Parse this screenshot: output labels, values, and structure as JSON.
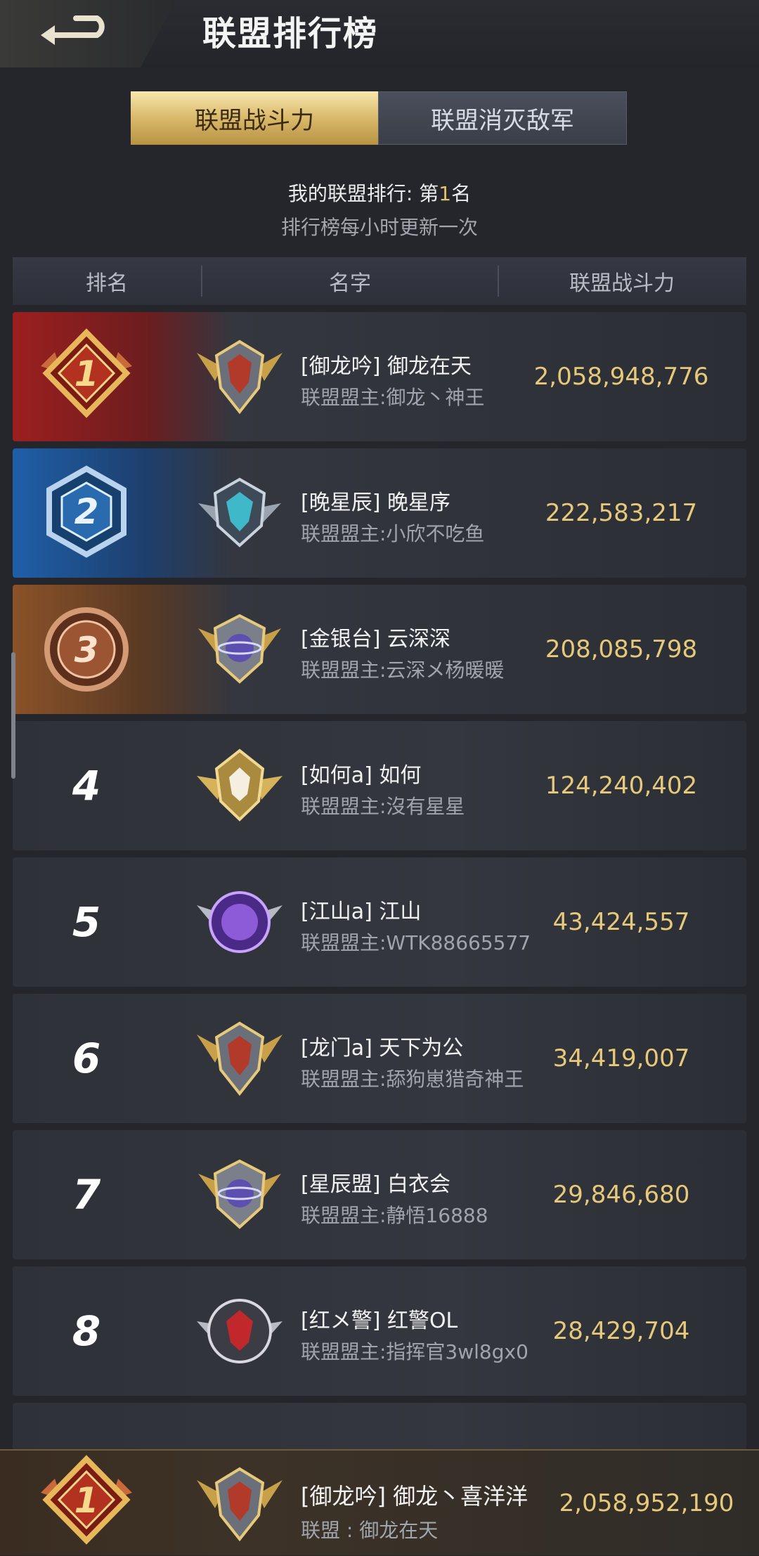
{
  "header": {
    "title": "联盟排行榜"
  },
  "tabs": [
    {
      "label": "联盟战斗力",
      "active": true
    },
    {
      "label": "联盟消灭敌军",
      "active": false
    }
  ],
  "my_rank": {
    "prefix": "我的联盟排行: 第",
    "number": "1",
    "suffix": "名"
  },
  "update_note": "排行榜每小时更新一次",
  "table": {
    "columns": [
      "排名",
      "名字",
      "联盟战斗力"
    ],
    "rows": [
      {
        "rank": "1",
        "name": "[御龙吟] 御龙在天",
        "leader": "联盟盟主:御龙丶神王",
        "power": "2,058,948,776"
      },
      {
        "rank": "2",
        "name": "[晚星辰] 晚星序",
        "leader": "联盟盟主:小欣不吃鱼",
        "power": "222,583,217"
      },
      {
        "rank": "3",
        "name": "[金银台] 云深深",
        "leader": "联盟盟主:云深メ杨暖暖",
        "power": "208,085,798"
      },
      {
        "rank": "4",
        "name": "[如何a] 如何",
        "leader": "联盟盟主:沒有星星",
        "power": "124,240,402"
      },
      {
        "rank": "5",
        "name": "[江山a] 江山",
        "leader": "联盟盟主:WTK88665577",
        "power": "43,424,557"
      },
      {
        "rank": "6",
        "name": "[龙门a] 天下为公",
        "leader": "联盟盟主:舔狗崽猎奇神王",
        "power": "34,419,007"
      },
      {
        "rank": "7",
        "name": "[星辰盟] 白衣会",
        "leader": "联盟盟主:静悟16888",
        "power": "29,846,680"
      },
      {
        "rank": "8",
        "name": "[红メ警] 红警OL",
        "leader": "联盟盟主:指挥官3wl8gx0",
        "power": "28,429,704"
      }
    ]
  },
  "my_entry": {
    "rank": "1",
    "name": "[御龙吟] 御龙丶喜洋洋",
    "leader": "联盟 : 御龙在天",
    "power": "2,058,952,190"
  },
  "colors": {
    "gold": "#e6c97a",
    "rank1": "#9c1f1f",
    "rank2": "#1f5fa8",
    "rank3": "#8a5229"
  }
}
